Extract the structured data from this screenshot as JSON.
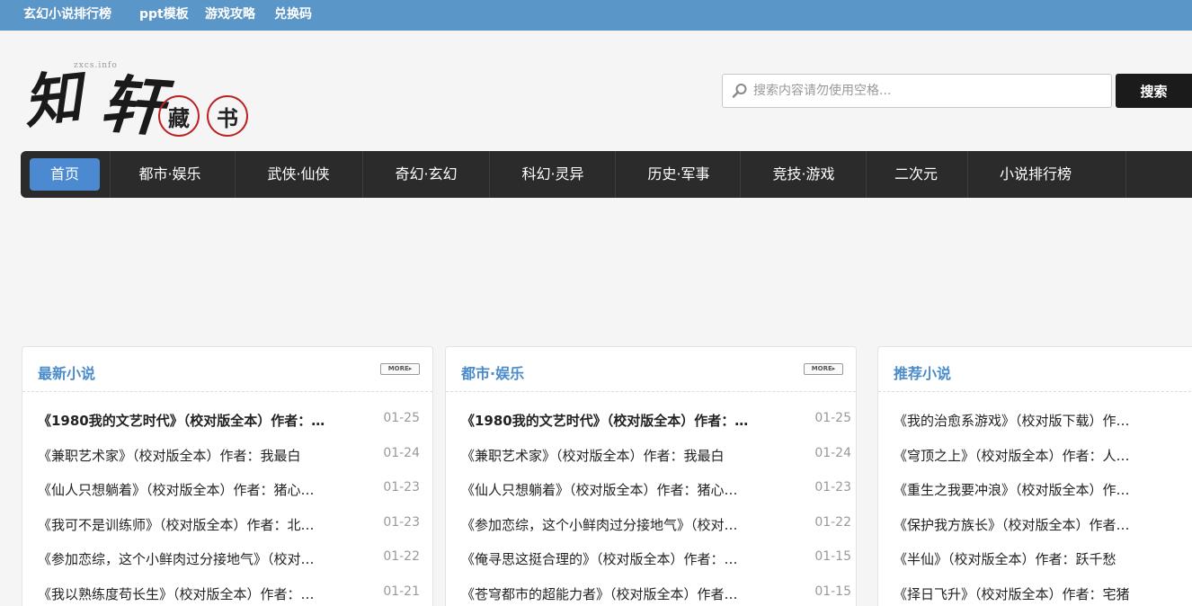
{
  "top_links": [
    "玄幻小说排行榜",
    "ppt模板",
    "游戏攻略",
    "兑换码"
  ],
  "logo": {
    "text": "知轩藏书",
    "small": "zxcs.info"
  },
  "search": {
    "placeholder": "搜索内容请勿使用空格...",
    "button": "搜索"
  },
  "nav": [
    "首页",
    "都市·娱乐",
    "武侠·仙侠",
    "奇幻·玄幻",
    "科幻·灵异",
    "历史·军事",
    "竞技·游戏",
    "二次元",
    "小说排行榜"
  ],
  "more_label": "MORE▸",
  "panels": [
    {
      "title": "最新小说",
      "has_more": true,
      "rows": [
        {
          "text": "《1980我的文艺时代》（校对版全本）作者：…",
          "date": "01-25",
          "bold": true
        },
        {
          "text": "《兼职艺术家》（校对版全本）作者：我最白",
          "date": "01-24"
        },
        {
          "text": "《仙人只想躺着》（校对版全本）作者：猪心…",
          "date": "01-23"
        },
        {
          "text": "《我可不是训练师》（校对版全本）作者：北…",
          "date": "01-23"
        },
        {
          "text": "《参加恋综，这个小鲜肉过分接地气》（校对…",
          "date": "01-22"
        },
        {
          "text": "《我以熟练度苟长生》（校对版全本）作者：…",
          "date": "01-21"
        }
      ]
    },
    {
      "title": "都市·娱乐",
      "has_more": true,
      "rows": [
        {
          "text": "《1980我的文艺时代》（校对版全本）作者：…",
          "date": "01-25",
          "bold": true
        },
        {
          "text": "《兼职艺术家》（校对版全本）作者：我最白",
          "date": "01-24"
        },
        {
          "text": "《仙人只想躺着》（校对版全本）作者：猪心…",
          "date": "01-23"
        },
        {
          "text": "《参加恋综，这个小鲜肉过分接地气》（校对…",
          "date": "01-22"
        },
        {
          "text": "《俺寻思这挺合理的》（校对版全本）作者：…",
          "date": "01-15"
        },
        {
          "text": "《苍穹都市的超能力者》（校对版全本）作者…",
          "date": "01-15"
        }
      ]
    },
    {
      "title": "推荐小说",
      "has_more": false,
      "rows": [
        {
          "text": "《我的治愈系游戏》（校对版下载）作…",
          "date": ""
        },
        {
          "text": "《穹顶之上》（校对版全本）作者：人…",
          "date": ""
        },
        {
          "text": "《重生之我要冲浪》（校对版全本）作…",
          "date": ""
        },
        {
          "text": "《保护我方族长》（校对版全本）作者…",
          "date": ""
        },
        {
          "text": "《半仙》（校对版全本）作者：跃千愁",
          "date": ""
        },
        {
          "text": "《择日飞升》（校对版全本）作者：宅猪",
          "date": ""
        }
      ]
    }
  ]
}
